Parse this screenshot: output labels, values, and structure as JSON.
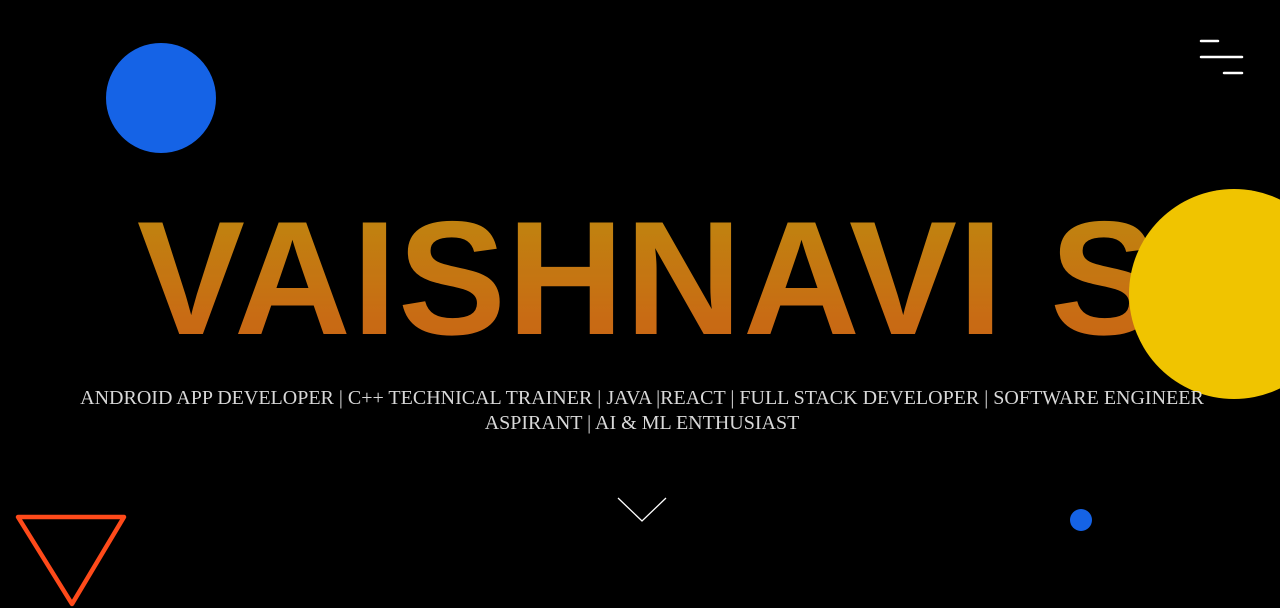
{
  "hero": {
    "name": "VAISHNAVI S",
    "subtitle": "ANDROID APP DEVELOPER | C++ TECHNICAL TRAINER | JAVA |REACT | FULL STACK DEVELOPER | SOFTWARE ENGINEER ASPIRANT | AI & ML ENTHUSIAST"
  },
  "icons": {
    "menu": "hamburger-menu-icon",
    "scroll": "chevron-down-icon"
  },
  "colors": {
    "background": "#000000",
    "blue": "#1563e6",
    "yellow": "#f0c400",
    "orange": "#ff4a1a",
    "name_gradient_top": "#cf9410",
    "name_gradient_bottom": "#dd6a18",
    "subtitle": "#d8d8d8"
  }
}
